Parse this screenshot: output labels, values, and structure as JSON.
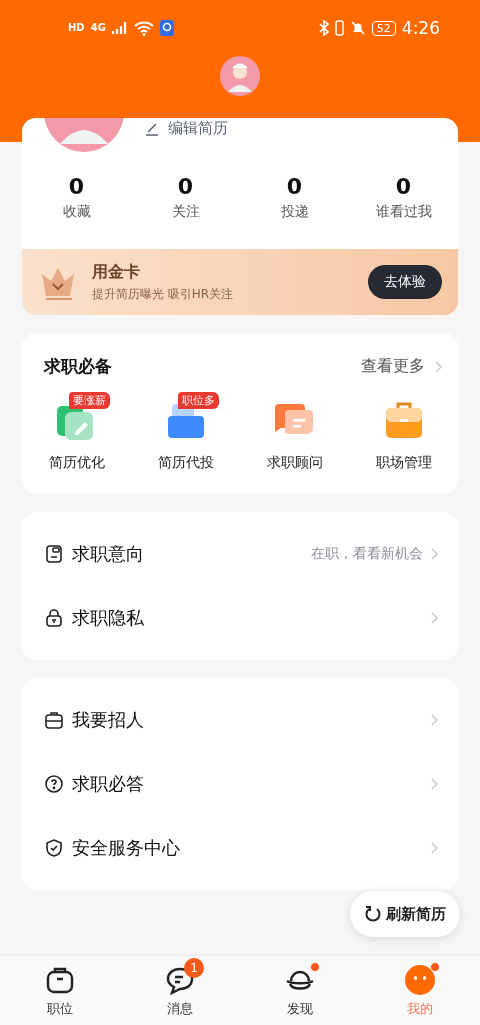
{
  "status_bar": {
    "left": [
      "HD",
      "4G"
    ],
    "battery": "52",
    "time": "4:26"
  },
  "profile": {
    "edit_label": "编辑简历"
  },
  "stats": [
    {
      "value": "0",
      "label": "收藏"
    },
    {
      "value": "0",
      "label": "关注"
    },
    {
      "value": "0",
      "label": "投递"
    },
    {
      "value": "0",
      "label": "谁看过我"
    }
  ],
  "gold_card": {
    "title": "用金卡",
    "subtitle": "提升简历曝光 吸引HR关注",
    "button": "去体验"
  },
  "essentials": {
    "title": "求职必备",
    "more": "查看更多",
    "tools": [
      {
        "kind": "resume",
        "label": "简历优化",
        "badge": "要涨薪"
      },
      {
        "kind": "delivery",
        "label": "简历代投",
        "badge": "职位多"
      },
      {
        "kind": "advisor",
        "label": "求职顾问"
      },
      {
        "kind": "career",
        "label": "职场管理"
      }
    ]
  },
  "menu_groups": [
    [
      {
        "kind": "intent",
        "label": "求职意向",
        "value": "在职，看看新机会"
      },
      {
        "kind": "privacy",
        "label": "求职隐私"
      }
    ],
    [
      {
        "kind": "recruit",
        "label": "我要招人"
      },
      {
        "kind": "faq",
        "label": "求职必答"
      },
      {
        "kind": "safety",
        "label": "安全服务中心"
      }
    ]
  ],
  "refresh_button": "刷新简历",
  "tabs": [
    {
      "kind": "jobs",
      "label": "职位",
      "selected": false
    },
    {
      "kind": "messages",
      "label": "消息",
      "selected": false,
      "badge": "1"
    },
    {
      "kind": "discover",
      "label": "发现",
      "selected": false,
      "dot": true
    },
    {
      "kind": "me",
      "label": "我的",
      "selected": true,
      "dot": true
    }
  ]
}
